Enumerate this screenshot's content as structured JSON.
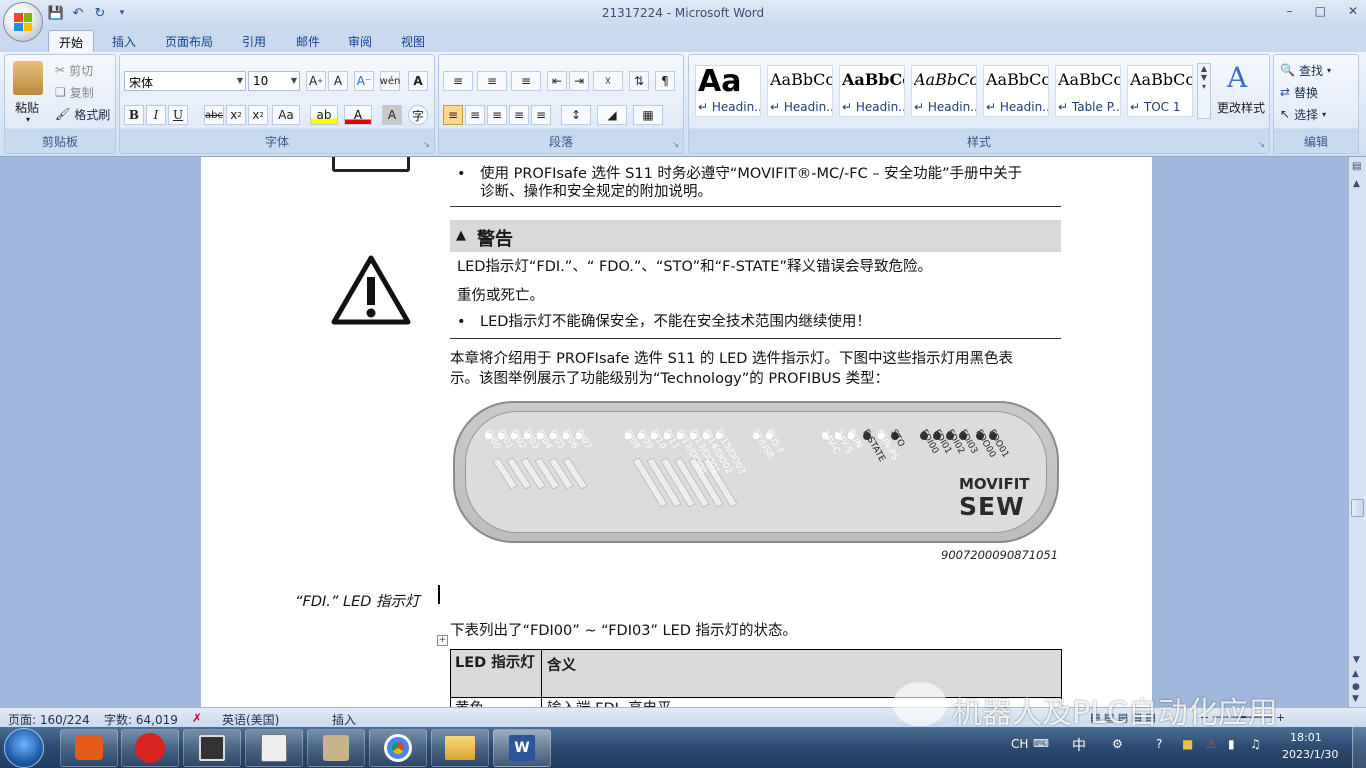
{
  "window": {
    "title": "21317224 - Microsoft Word",
    "controls": [
      "–",
      "□",
      "✕"
    ]
  },
  "tabs": [
    "开始",
    "插入",
    "页面布局",
    "引用",
    "邮件",
    "审阅",
    "视图"
  ],
  "ribbon": {
    "clipboard": {
      "label": "剪贴板",
      "paste": "粘贴",
      "cut": "剪切",
      "copy": "复制",
      "format_painter": "格式刷"
    },
    "font": {
      "label": "字体",
      "name": "宋体",
      "size": "10"
    },
    "paragraph": {
      "label": "段落"
    },
    "styles": {
      "label": "样式",
      "items": [
        {
          "sample": "Aa",
          "name": "↵ Headin..."
        },
        {
          "sample": "AaBbCc",
          "name": "↵ Headin..."
        },
        {
          "sample": "AaBbCcI",
          "name": "↵ Headin..."
        },
        {
          "sample": "AaBbCcDd",
          "name": "↵ Headin..."
        },
        {
          "sample": "AaBbCcD",
          "name": "↵ Headin..."
        },
        {
          "sample": "AaBbCcI",
          "name": "↵ Table P..."
        },
        {
          "sample": "AaBbCcD",
          "name": "↵ TOC 1"
        }
      ],
      "change_styles": "更改样式"
    },
    "editing": {
      "label": "编辑",
      "find": "查找",
      "replace": "替换",
      "select": "选择"
    }
  },
  "document": {
    "bullet1_line1": "使用 PROFIsafe 选件 S11 时务必遵守“MOVIFIT®-MC/-FC – 安全功能”手册中关于",
    "bullet1_line2": "诊断、操作和安全规定的附加说明。",
    "warning_title": "警告",
    "warning_line1": "LED指示灯“FDI.”、“ FDO.”、“STO”和“F-STATE”释义错误会导致危险。",
    "warning_line2": "重伤或死亡。",
    "warning_bullet": "LED指示灯不能确保安全，不能在安全技术范围内继续使用！",
    "intro_line1": "本章将介绍用于 PROFIsafe 选件 S11 的 LED 选件指示灯。下图中这些指示灯用黑色表",
    "intro_line2": "示。该图举例展示了功能级别为“Technology”的 PROFIBUS 类型：",
    "figure_id": "9007200090871051",
    "device_labels": {
      "brand": "MOVIFIT",
      "maker": "SEW",
      "group1": [
        "DI00",
        "DI01",
        "DI02",
        "DI03",
        "DI04",
        "DI05",
        "DI06",
        "DI07"
      ],
      "group2": [
        "DI08",
        "DI09",
        "DI10",
        "DI11",
        "DI12/DO00",
        "DI13/DO01",
        "DI14/DO02",
        "DI15/DO03"
      ],
      "group3": [
        "SF/USR",
        "BUS-F"
      ],
      "group4": [
        "24V-C",
        "24V-S",
        "RUN",
        "F-STATE",
        "RUN-PS",
        "STO"
      ],
      "group5": [
        "FDI00",
        "FDI01",
        "FDI02",
        "FDI03",
        "FDO00",
        "FDO01"
      ]
    },
    "side_heading": "“FDI.” LED 指示灯",
    "table_intro": "下表列出了“FDI00” ~ “FDI03” LED 指示灯的状态。",
    "table_headers": [
      "LED 指示灯",
      "含义"
    ],
    "table_row_partial": [
      "黄色",
      "输入端 FDI. 高电平"
    ]
  },
  "status": {
    "page": "页面: 160/224",
    "words": "字数: 64,019",
    "language": "英语(美国)",
    "mode": "插入"
  },
  "watermark": "机器人及PLC自动化应用",
  "taskbar": {
    "tray_lang": "CH",
    "tray_ime": "中",
    "time": "18:01",
    "date": "2023/1/30"
  },
  "colors": {
    "accent": "#2b579a",
    "warning_bar": "#d9d9d9",
    "ribbon": "#dbe7f6"
  }
}
